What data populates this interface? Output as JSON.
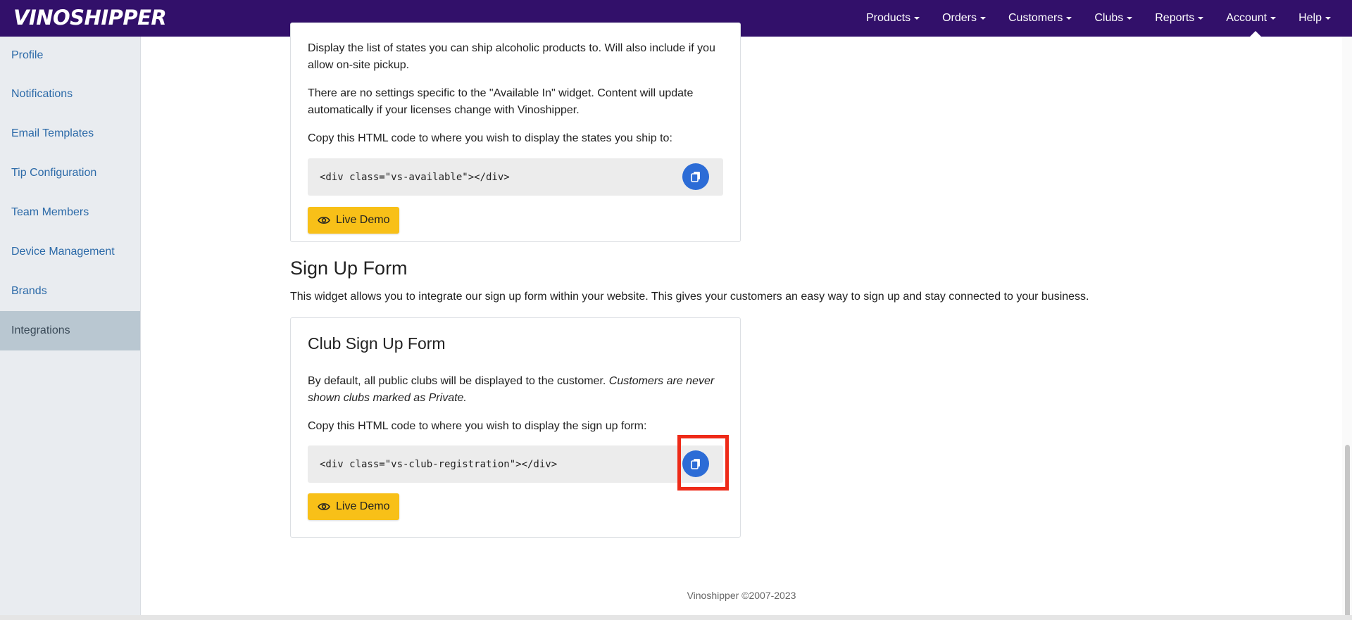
{
  "brand": {
    "logo_text": "VINOSHIPPER"
  },
  "nav": {
    "items": [
      {
        "label": "Products"
      },
      {
        "label": "Orders"
      },
      {
        "label": "Customers"
      },
      {
        "label": "Clubs"
      },
      {
        "label": "Reports"
      },
      {
        "label": "Account",
        "active": true
      },
      {
        "label": "Help"
      }
    ]
  },
  "sidebar": {
    "items": [
      {
        "label": "Profile"
      },
      {
        "label": "Notifications"
      },
      {
        "label": "Email Templates"
      },
      {
        "label": "Tip Configuration"
      },
      {
        "label": "Team Members"
      },
      {
        "label": "Device Management"
      },
      {
        "label": "Brands"
      },
      {
        "label": "Integrations",
        "active": true
      }
    ]
  },
  "available_card": {
    "intro_text": "Display the list of states you can ship alcoholic products to. Will also include if you allow on-site pickup.",
    "settings_text": "There are no settings specific to the \"Available In\" widget. Content will update automatically if your licenses change with Vinoshipper.",
    "copy_instruction": "Copy this HTML code to where you wish to display the states you ship to:",
    "code": "<div class=\"vs-available\"></div>",
    "demo_label": "Live Demo"
  },
  "signup_section": {
    "title": "Sign Up Form",
    "description": "This widget allows you to integrate our sign up form within your website. This gives your customers an easy way to sign up and stay connected to your business."
  },
  "club_card": {
    "title": "Club Sign Up Form",
    "default_text": "By default, all public clubs will be displayed to the customer.",
    "private_text": "Customers are never shown clubs marked as Private.",
    "copy_instruction": "Copy this HTML code to where you wish to display the sign up form:",
    "code": "<div class=\"vs-club-registration\"></div>",
    "demo_label": "Live Demo"
  },
  "footer": {
    "text": "Vinoshipper ©2007-2023"
  },
  "colors": {
    "topbar": "#32106a",
    "accent_button": "#f8c018",
    "copy_button": "#2c6cd6",
    "highlight": "#ee2a18",
    "link": "#2c6aa8"
  }
}
